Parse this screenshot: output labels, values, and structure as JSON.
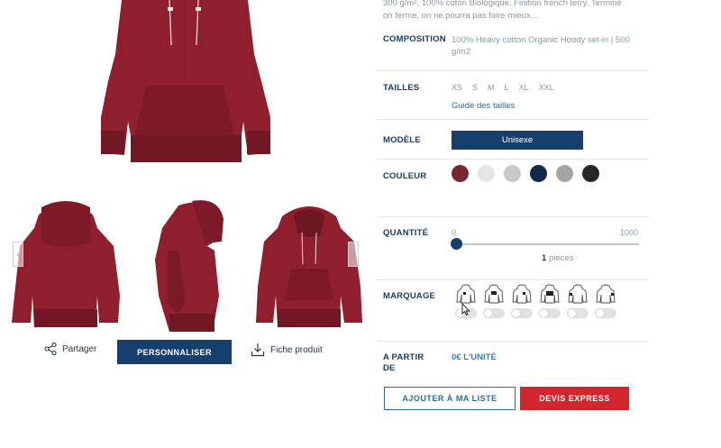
{
  "product": {
    "description_tail": [
      "300 g/m², 100% coton Biologique, Finition french terry. Terminé",
      "on ferme, on ne pourra pas faire mieux..."
    ]
  },
  "gallery": {
    "prev_icon": "chevron-left-icon",
    "next_icon": "chevron-right-icon"
  },
  "actions": {
    "share_label": "Partager",
    "personalize_label": "PERSONNALISER",
    "datasheet_label": "Fiche produit"
  },
  "specs": {
    "composition": {
      "label": "COMPOSITION",
      "value_line1": "100% Heavy cotton Organic Hoody set-in | 500",
      "value_line2": "g/m2"
    },
    "sizes": {
      "label": "TAILLES",
      "options": [
        "XS",
        "S",
        "M",
        "L",
        "XL",
        "XXL"
      ],
      "guide_label": "Guide des tailles"
    },
    "model": {
      "label": "MODÈLE",
      "selected": "Unisexe"
    },
    "color": {
      "label": "COULEUR",
      "swatches": [
        "#7a2733",
        "#e6e6e6",
        "#c9c9c9",
        "#0f2a4a",
        "#a6a3a3",
        "#26272b"
      ]
    },
    "quantity": {
      "label": "QUANTITÉ",
      "min": "0",
      "max": "1000",
      "current": "1",
      "unit": "pieces"
    },
    "marking": {
      "label": "MARQUAGE",
      "positions": [
        "front-left-chest",
        "front-center",
        "front-right-chest",
        "back",
        "left-sleeve",
        "right-sleeve"
      ]
    },
    "price": {
      "label_line1": "A PARTIR",
      "label_line2": "DE",
      "value": "0€ L'UNITÉ"
    }
  },
  "buttons": {
    "add_to_list": "AJOUTER À MA LISTE",
    "express_quote": "DEVIS EXPRESS"
  },
  "colors": {
    "primary": "#163f6b",
    "accent_red": "#d1262e",
    "link_blue": "#2e6aa0",
    "hoodie": "#8f1f2d"
  }
}
